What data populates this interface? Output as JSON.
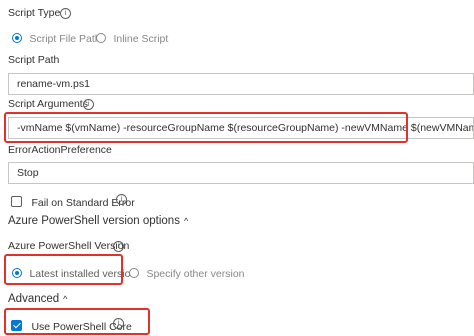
{
  "script_type": {
    "label": "Script Type",
    "options": [
      {
        "label": "Script File Path",
        "selected": true
      },
      {
        "label": "Inline Script",
        "selected": false
      }
    ]
  },
  "script_path": {
    "label": "Script Path",
    "value": "rename-vm.ps1"
  },
  "script_arguments": {
    "label": "Script Arguments",
    "value": "-vmName $(vmName) -resourceGroupName $(resourceGroupName) -newVMName $(newVMName)"
  },
  "error_action": {
    "label": "ErrorActionPreference",
    "value": "Stop"
  },
  "fail_on_stderr": {
    "label": "Fail on Standard Error",
    "checked": false
  },
  "azure_ps_options": {
    "title": "Azure PowerShell version options",
    "version_label": "Azure PowerShell Version",
    "options": [
      {
        "label": "Latest installed version",
        "selected": true
      },
      {
        "label": "Specify other version",
        "selected": false
      }
    ]
  },
  "advanced": {
    "title": "Advanced",
    "use_core_label": "Use PowerShell Core",
    "use_core_checked": true
  },
  "icons": {
    "info": "i",
    "chevron_up": "^"
  },
  "colors": {
    "accent": "#0078d4",
    "highlight": "#e0322b"
  }
}
